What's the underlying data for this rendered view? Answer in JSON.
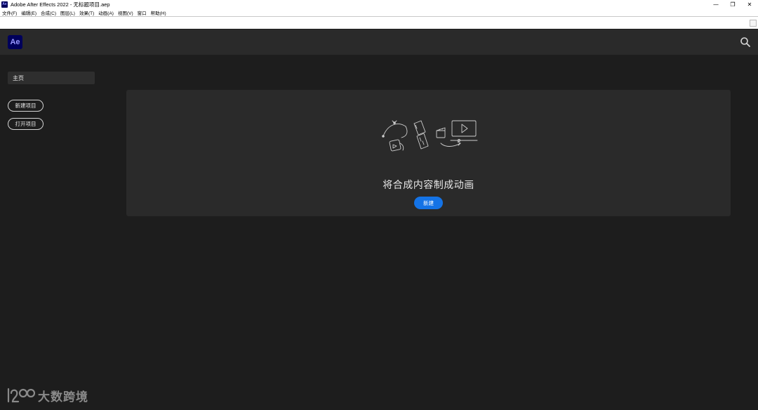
{
  "window": {
    "app_icon": "Ae",
    "title": "Adobe After Effects 2022 - 无标题项目.aep",
    "minimize": "—",
    "restore": "❐",
    "close": "✕"
  },
  "menu": [
    "文件(F)",
    "编辑(E)",
    "合成(C)",
    "图层(L)",
    "效果(T)",
    "动画(A)",
    "视图(V)",
    "窗口",
    "帮助(H)"
  ],
  "header": {
    "logo": "Ae",
    "search_icon": "search-icon"
  },
  "sidebar": {
    "home_label": "主页",
    "new_project": "新建项目",
    "open_project": "打开项目"
  },
  "main": {
    "title": "将合成内容制成动画",
    "create_button": "新建"
  },
  "watermark": {
    "text": "大数跨境"
  },
  "colors": {
    "ae_brand": "#00005b",
    "ae_brand_text": "#9999ff",
    "primary_button": "#1473e6",
    "background": "#1d1d1d",
    "panel": "#2a2a2a"
  }
}
